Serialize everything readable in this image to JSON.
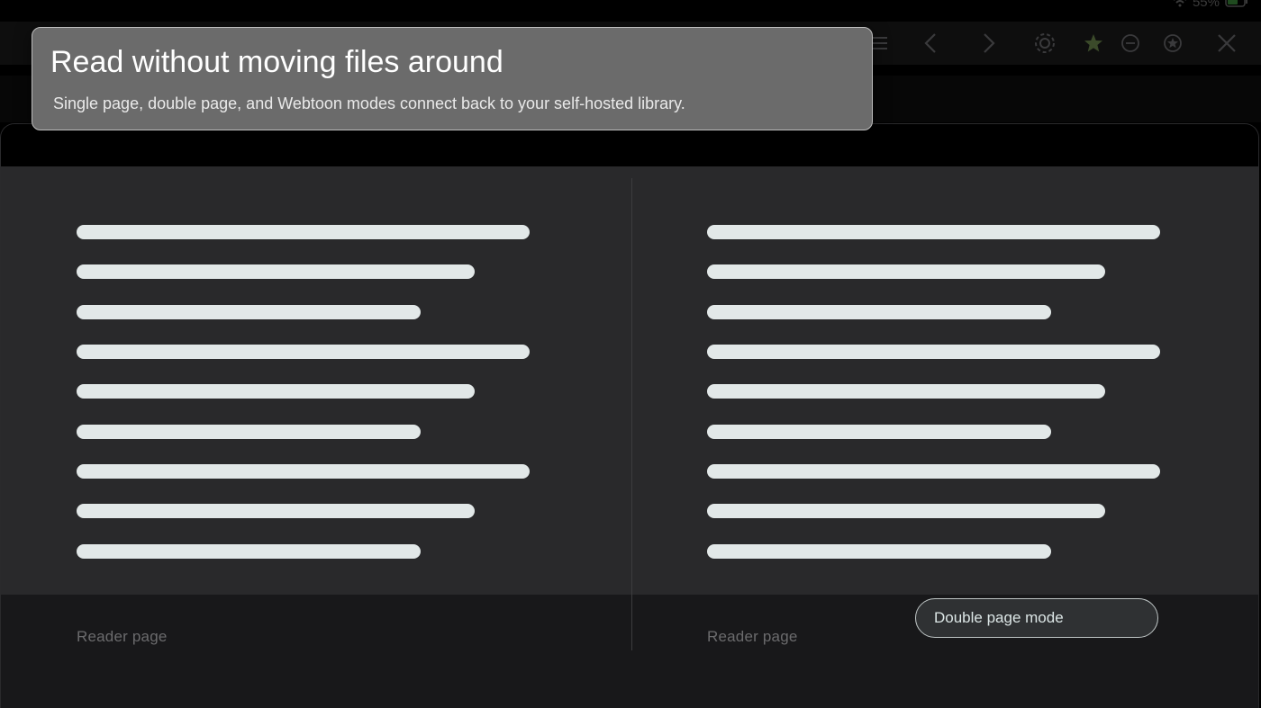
{
  "status_bar": {
    "battery": "55%"
  },
  "toolbar": {
    "icons": [
      "menu-icon",
      "chevron-left-icon",
      "chevron-right-icon",
      "gear-icon",
      "star-icon",
      "zoom-out-icon",
      "bookmark-icon",
      "close-icon"
    ],
    "star_color": "#3b4a2a"
  },
  "tooltip": {
    "title": "Read without moving files around",
    "subtitle": "Single page, double page, and Webtoon modes connect back to your self-hosted library."
  },
  "reader": {
    "left_page_label": "Reader page",
    "right_page_label": "Reader page",
    "mode_label": "Double page mode"
  },
  "colors": {
    "page_background": "#29292b",
    "text_line": "#e2e8e8",
    "tooltip_background": "#6b6b6b"
  }
}
